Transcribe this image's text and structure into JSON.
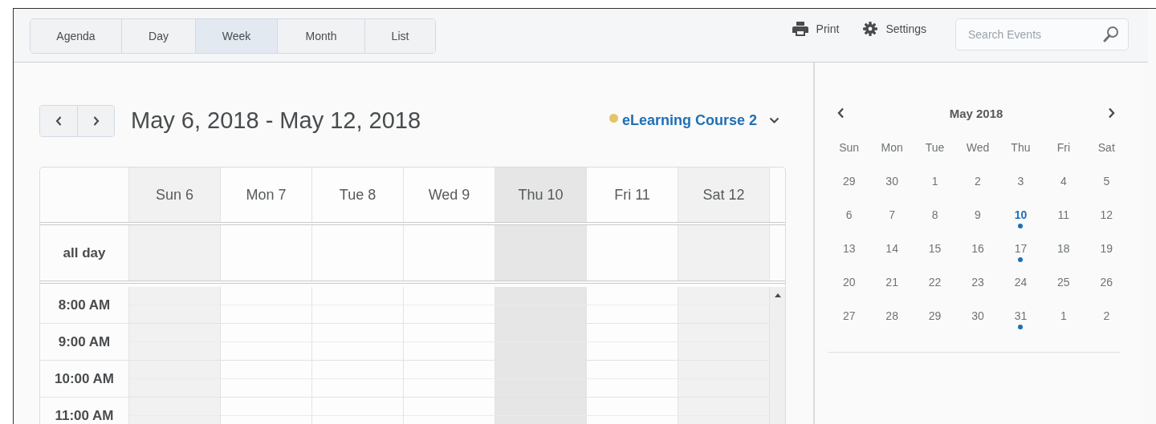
{
  "tabs": [
    {
      "label": "Agenda",
      "selected": false
    },
    {
      "label": "Day",
      "selected": false
    },
    {
      "label": "Week",
      "selected": true
    },
    {
      "label": "Month",
      "selected": false
    },
    {
      "label": "List",
      "selected": false
    }
  ],
  "actions": [
    {
      "kind": "print",
      "label": "Print"
    },
    {
      "kind": "settings",
      "label": "Settings"
    }
  ],
  "search": {
    "placeholder": "Search Events"
  },
  "range_title": "May 6, 2018 - May 12, 2018",
  "calendar_filter": {
    "label": "eLearning Course 2",
    "color": "#e2c56a"
  },
  "week": {
    "all_day_label": "all day",
    "days": [
      {
        "label": "Sun 6",
        "weekend": true,
        "today": false
      },
      {
        "label": "Mon 7",
        "weekend": false,
        "today": false
      },
      {
        "label": "Tue 8",
        "weekend": false,
        "today": false
      },
      {
        "label": "Wed 9",
        "weekend": false,
        "today": false
      },
      {
        "label": "Thu 10",
        "weekend": false,
        "today": true
      },
      {
        "label": "Fri 11",
        "weekend": false,
        "today": false
      },
      {
        "label": "Sat 12",
        "weekend": true,
        "today": false
      }
    ],
    "times": [
      "8:00 AM",
      "9:00 AM",
      "10:00 AM",
      "11:00 AM"
    ]
  },
  "mini_calendar": {
    "title": "May 2018",
    "weekdays": [
      "Sun",
      "Mon",
      "Tue",
      "Wed",
      "Thu",
      "Fri",
      "Sat"
    ],
    "weeks": [
      [
        {
          "day": "29",
          "selected": false,
          "has_event": false
        },
        {
          "day": "30",
          "selected": false,
          "has_event": false
        },
        {
          "day": "1",
          "selected": false,
          "has_event": false
        },
        {
          "day": "2",
          "selected": false,
          "has_event": false
        },
        {
          "day": "3",
          "selected": false,
          "has_event": false
        },
        {
          "day": "4",
          "selected": false,
          "has_event": false
        },
        {
          "day": "5",
          "selected": false,
          "has_event": false
        }
      ],
      [
        {
          "day": "6",
          "selected": false,
          "has_event": false
        },
        {
          "day": "7",
          "selected": false,
          "has_event": false
        },
        {
          "day": "8",
          "selected": false,
          "has_event": false
        },
        {
          "day": "9",
          "selected": false,
          "has_event": false
        },
        {
          "day": "10",
          "selected": true,
          "has_event": true
        },
        {
          "day": "11",
          "selected": false,
          "has_event": false
        },
        {
          "day": "12",
          "selected": false,
          "has_event": false
        }
      ],
      [
        {
          "day": "13",
          "selected": false,
          "has_event": false
        },
        {
          "day": "14",
          "selected": false,
          "has_event": false
        },
        {
          "day": "15",
          "selected": false,
          "has_event": false
        },
        {
          "day": "16",
          "selected": false,
          "has_event": false
        },
        {
          "day": "17",
          "selected": false,
          "has_event": true
        },
        {
          "day": "18",
          "selected": false,
          "has_event": false
        },
        {
          "day": "19",
          "selected": false,
          "has_event": false
        }
      ],
      [
        {
          "day": "20",
          "selected": false,
          "has_event": false
        },
        {
          "day": "21",
          "selected": false,
          "has_event": false
        },
        {
          "day": "22",
          "selected": false,
          "has_event": false
        },
        {
          "day": "23",
          "selected": false,
          "has_event": false
        },
        {
          "day": "24",
          "selected": false,
          "has_event": false
        },
        {
          "day": "25",
          "selected": false,
          "has_event": false
        },
        {
          "day": "26",
          "selected": false,
          "has_event": false
        }
      ],
      [
        {
          "day": "27",
          "selected": false,
          "has_event": false
        },
        {
          "day": "28",
          "selected": false,
          "has_event": false
        },
        {
          "day": "29",
          "selected": false,
          "has_event": false
        },
        {
          "day": "30",
          "selected": false,
          "has_event": false
        },
        {
          "day": "31",
          "selected": false,
          "has_event": true
        },
        {
          "day": "1",
          "selected": false,
          "has_event": false
        },
        {
          "day": "2",
          "selected": false,
          "has_event": false
        }
      ]
    ]
  }
}
